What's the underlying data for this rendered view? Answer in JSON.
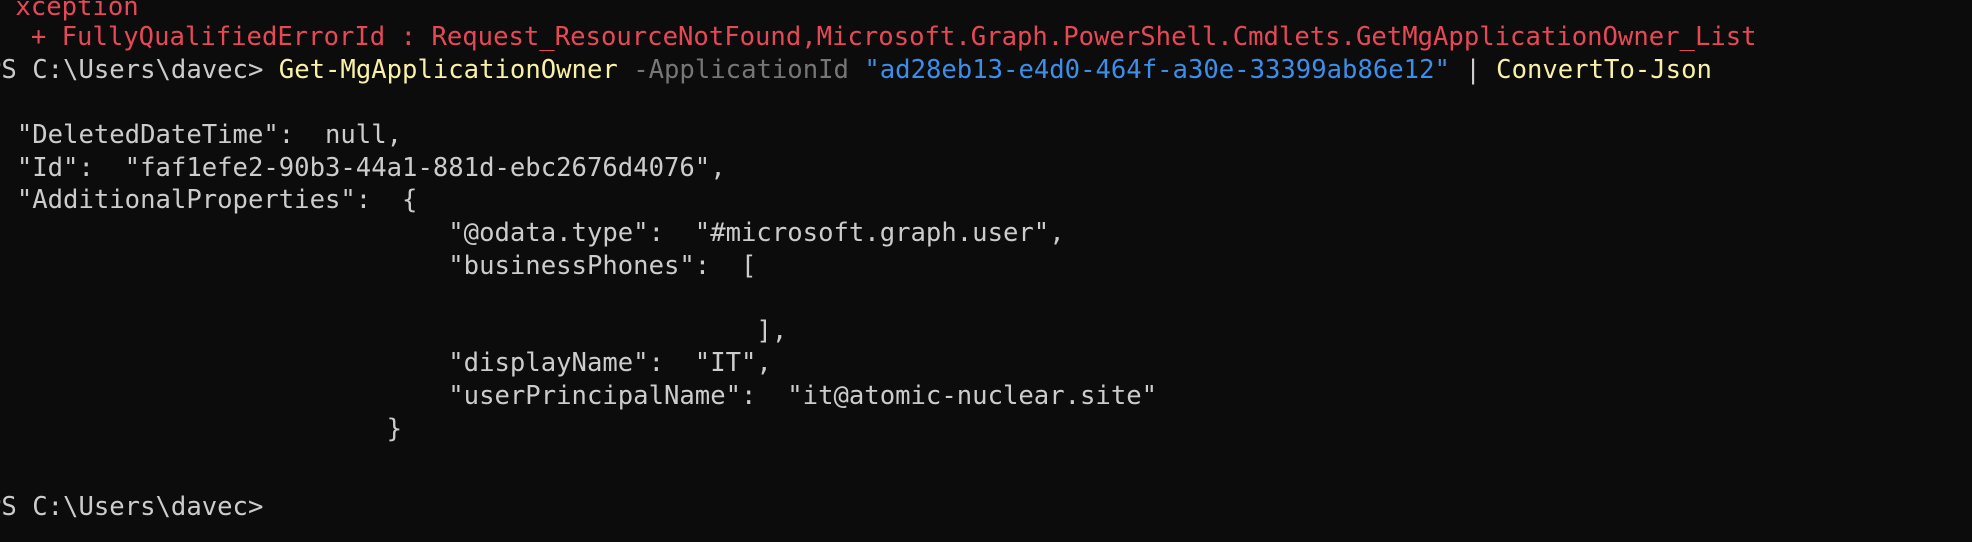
{
  "terminal": {
    "error_line_1": " xception",
    "error_line_2": "  + FullyQualifiedErrorId : Request_ResourceNotFound,Microsoft.Graph.PowerShell.Cmdlets.GetMgApplicationOwner_List",
    "prompt": "PS C:\\Users\\davec> ",
    "command": {
      "cmdlet": "Get-MgApplicationOwner",
      "param": "-ApplicationId",
      "value": "\"ad28eb13-e4d0-464f-a30e-33399ab86e12\"",
      "pipe": "|",
      "pipe_cmdlet": "ConvertTo-Json"
    },
    "output": {
      "open_bracket": "[",
      "lines": [
        "  \"DeletedDateTime\":  null,",
        "  \"Id\":  \"faf1efe2-90b3-44a1-881d-ebc2676d4076\",",
        "  \"AdditionalProperties\":  {",
        "                              \"@odata.type\":  \"#microsoft.graph.user\",",
        "                              \"businessPhones\":  [",
        "",
        "                                                  ],",
        "                              \"displayName\":  \"IT\",",
        "                              \"userPrincipalName\":  \"it@atomic-nuclear.site\"",
        "                          }"
      ],
      "close_bracket": "]"
    },
    "final_prompt": "PS C:\\Users\\davec>"
  },
  "colors": {
    "background": "#0c0c0c",
    "foreground": "#cccccc",
    "error": "#e74856",
    "cmdlet": "#f9f1a5",
    "parameter": "#767676",
    "string": "#3b8eea"
  }
}
